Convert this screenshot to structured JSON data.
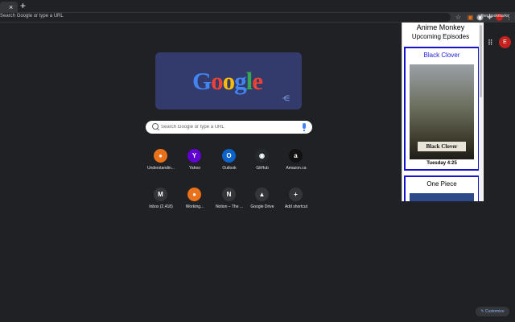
{
  "browser": {
    "tab_close": "×",
    "new_tab": "+",
    "address_placeholder": "Search Google or type a URL",
    "bookmarks_label": "ther bookmarks"
  },
  "newtab": {
    "doodle_text": "Google",
    "search_placeholder": "Search Google or type a URL",
    "shortcuts_row1": [
      {
        "label": "Understandin...",
        "glyph": "●",
        "color": "#e8711a"
      },
      {
        "label": "Yahoo",
        "glyph": "Y",
        "color": "#6001d2"
      },
      {
        "label": "Outlook",
        "glyph": "O",
        "color": "#0a64c9"
      },
      {
        "label": "GitHub",
        "glyph": "◉",
        "color": "#24292e"
      },
      {
        "label": "Amazon.ca",
        "glyph": "a",
        "color": "#111111"
      }
    ],
    "shortcuts_row2": [
      {
        "label": "Inbox (2,418)",
        "glyph": "M",
        "color": "#35363a"
      },
      {
        "label": "Working...",
        "glyph": "●",
        "color": "#e8711a"
      },
      {
        "label": "Notion – The ...",
        "glyph": "N",
        "color": "#35363a"
      },
      {
        "label": "Google Drive",
        "glyph": "▲",
        "color": "#35363a"
      },
      {
        "label": "Add shortcut",
        "glyph": "+",
        "color": "#35363a"
      }
    ],
    "customize_label": "Customize",
    "avatar_initial": "E"
  },
  "popup": {
    "title": "Anime Monkey",
    "subtitle": "Upcoming Episodes",
    "episodes": [
      {
        "name": "Black Clover",
        "time": "Tuesday 4:25",
        "logo": "Black Clover"
      },
      {
        "name": "One Piece"
      }
    ],
    "accent_color": "#1515ce"
  }
}
